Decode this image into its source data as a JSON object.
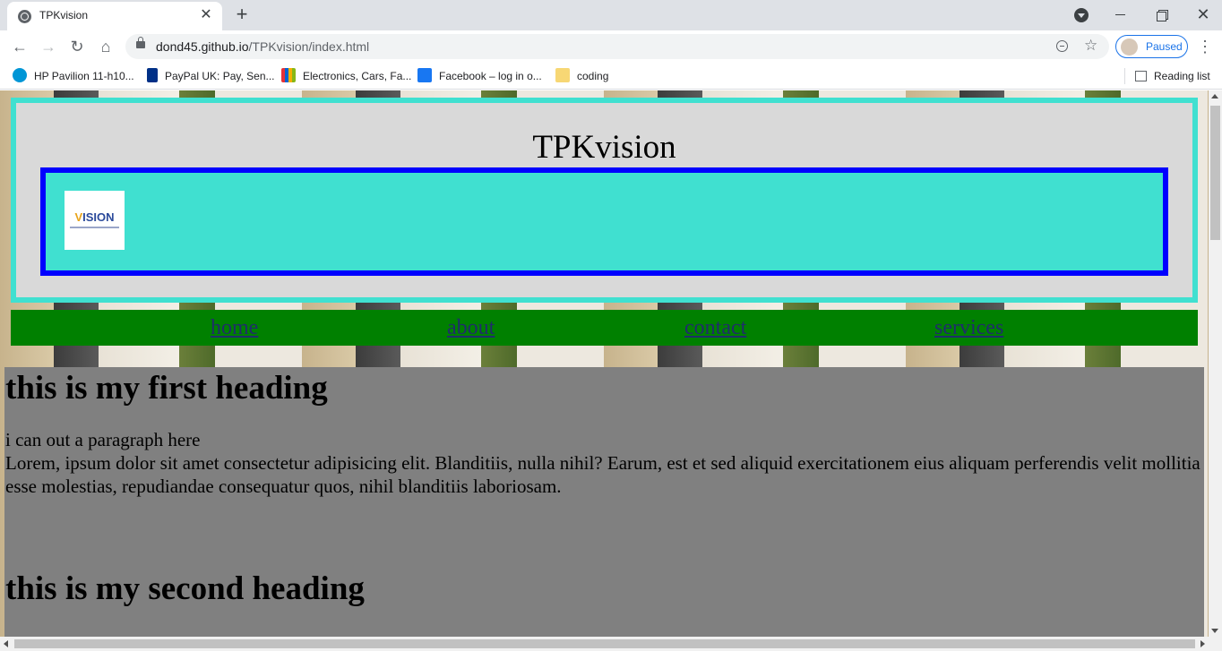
{
  "browser": {
    "tab_title": "TPKvision",
    "new_tab": "+",
    "url_host": "dond45.github.io",
    "url_path": "/TPKvision/index.html",
    "profile_label": "Paused",
    "bookmarks": [
      {
        "label": "HP Pavilion 11-h10...",
        "icon": "hp-icon"
      },
      {
        "label": "PayPal UK: Pay, Sen...",
        "icon": "paypal-icon"
      },
      {
        "label": "Electronics, Cars, Fa...",
        "icon": "ebay-icon"
      },
      {
        "label": "Facebook – log in o...",
        "icon": "facebook-icon"
      },
      {
        "label": "coding",
        "icon": "folder-icon"
      }
    ],
    "reading_list": "Reading list"
  },
  "page": {
    "site_title": "TPKvision",
    "logo_text_v": "V",
    "logo_text_rest": "ISION",
    "nav": [
      "home",
      "about",
      "contact",
      "services"
    ],
    "heading1": "this is my first heading",
    "paragraph1": "i can out a paragraph here",
    "paragraph2": "Lorem, ipsum dolor sit amet consectetur adipisicing elit. Blanditiis, nulla nihil? Earum, est et sed aliquid exercitationem eius aliquam perferendis velit mollitia esse molestias, repudiandae consequatur quos, nihil blanditiis laboriosam.",
    "heading2": "this is my second heading"
  },
  "colors": {
    "header_bg": "#d9d9d9",
    "header_border": "#40e0d0",
    "logo_band_bg": "#40e0d0",
    "logo_band_border": "#0000ff",
    "nav_bg": "#008000",
    "content_bg": "#808080"
  }
}
